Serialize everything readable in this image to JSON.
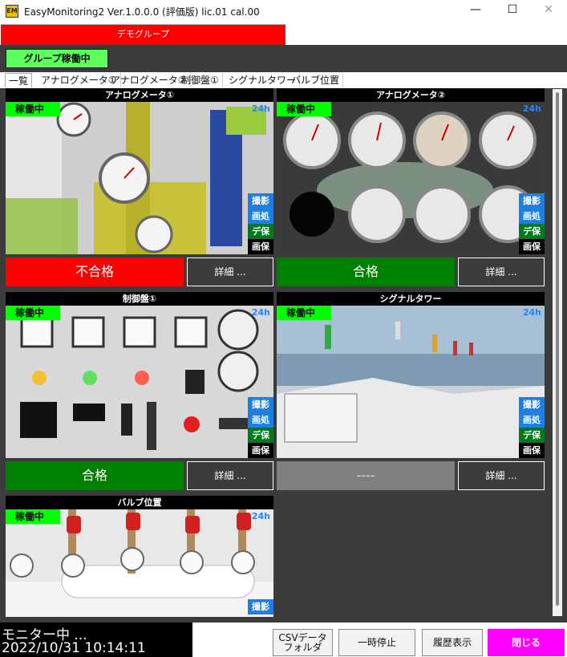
{
  "window": {
    "app_icon": "EM",
    "title": "EasyMonitoring2 Ver.1.0.0.0 (評価版)  lic.01 cal.00",
    "minimize_icon": "minimize-icon",
    "maximize_icon": "maximize-icon",
    "close_icon": "close-icon"
  },
  "group_tab": {
    "label": "デモグループ",
    "color": "#ff0000"
  },
  "group_status": {
    "label": "グループ稼働中",
    "color": "#5cff5c"
  },
  "subtabs": [
    "一覧",
    "アナログメータ①",
    "アナログメータ②",
    "制御盤①",
    "シグナルタワー",
    "バルブ位置"
  ],
  "cards": [
    {
      "title": "アナログメータ①",
      "badge": "稼働中",
      "h24": "24h",
      "btn_shoot": "撮影",
      "btn_process": "画処",
      "btn_save": "デ保",
      "btn_image": "画保",
      "result": "不合格",
      "result_color": "#ff0000",
      "detail": "詳細 ..."
    },
    {
      "title": "アナログメータ②",
      "badge": "稼働中",
      "h24": "24h",
      "btn_shoot": "撮影",
      "btn_process": "画処",
      "btn_save": "デ保",
      "btn_image": "画保",
      "result": "合格",
      "result_color": "#008000",
      "detail": "詳細 ..."
    },
    {
      "title": "制御盤①",
      "badge": "稼働中",
      "h24": "24h",
      "btn_shoot": "撮影",
      "btn_process": "画処",
      "btn_save": "デ保",
      "btn_image": "画保",
      "result": "合格",
      "result_color": "#008000",
      "detail": "詳細 ..."
    },
    {
      "title": "シグナルタワー",
      "badge": "稼働中",
      "h24": "24h",
      "btn_shoot": "撮影",
      "btn_process": "画処",
      "btn_save": "デ保",
      "btn_image": "画保",
      "result": "----",
      "result_color": "#7f7f7f",
      "detail": "詳細 ..."
    },
    {
      "title": "バルブ位置",
      "badge": "稼働中",
      "h24": "24h",
      "btn_shoot": "撮影"
    }
  ],
  "footer": {
    "monitor_state": "モニター中 ...",
    "monitor_time": "2022/10/31 10:14:11",
    "csv_line1": "CSVデータ",
    "csv_line2": "フォルダ",
    "pause": "一時停止",
    "history": "履歴表示",
    "close": "閉じる",
    "close_color": "#ff00ff"
  }
}
